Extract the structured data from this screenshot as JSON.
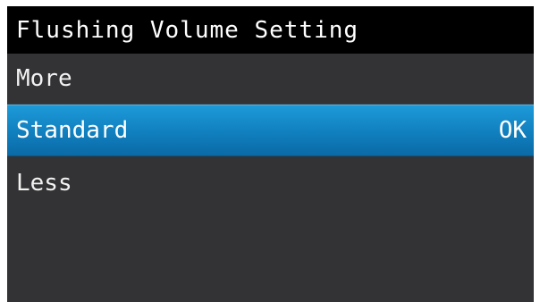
{
  "header": {
    "title": "Flushing Volume Setting"
  },
  "menu": {
    "items": [
      {
        "label": "More",
        "selected": false
      },
      {
        "label": "Standard",
        "selected": true,
        "status": "OK"
      },
      {
        "label": "Less",
        "selected": false
      }
    ]
  },
  "colors": {
    "background": "#333335",
    "title_bar": "#000000",
    "selection": "#117fbe",
    "text": "#f2f2f2"
  }
}
